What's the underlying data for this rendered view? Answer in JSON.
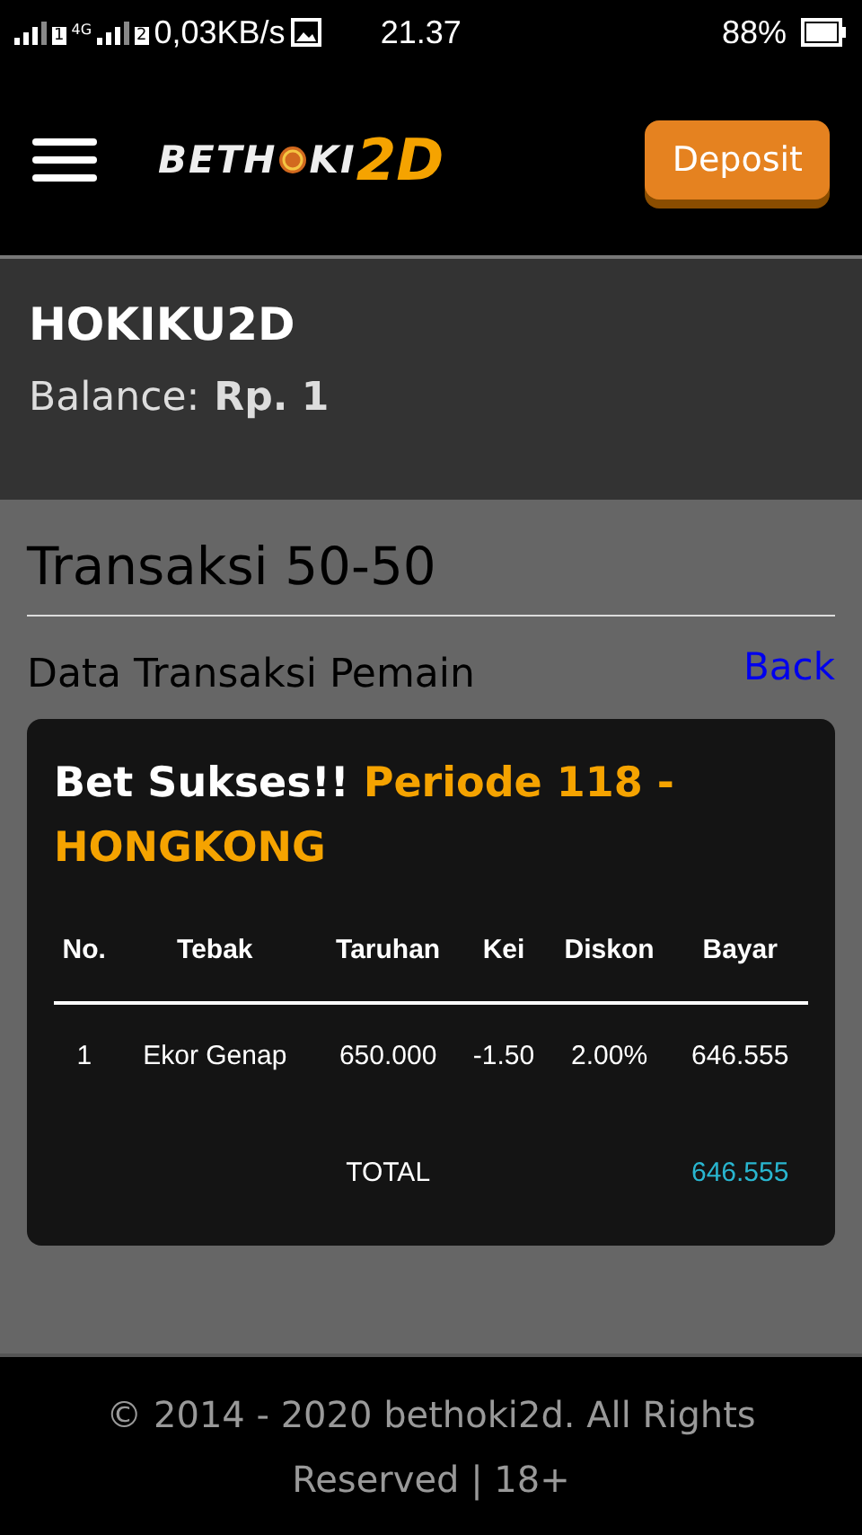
{
  "status_bar": {
    "sim_1": "1",
    "network": "4G",
    "sim_2": "2",
    "speed": "0,03KB/s",
    "time": "21.37",
    "battery": "88%"
  },
  "header": {
    "logo": {
      "left": "BETH",
      "right": "KI",
      "suffix": "2D"
    },
    "deposit_button": "Deposit"
  },
  "account": {
    "username": "HOKIKU2D",
    "balance_label": "Balance:",
    "balance_value": "Rp. 1"
  },
  "page": {
    "title": "Transaksi 50-50",
    "subtitle": "Data Transaksi Pemain",
    "back_link": "Back"
  },
  "card": {
    "title": "Bet Sukses!!",
    "period": "Periode 118 - HONGKONG",
    "columns": [
      "No.",
      "Tebak",
      "Taruhan",
      "Kei",
      "Diskon",
      "Bayar"
    ],
    "rows": [
      [
        "1",
        "Ekor Genap",
        "650.000",
        "-1.50",
        "2.00%",
        "646.555"
      ]
    ],
    "total_label": "TOTAL",
    "total_value": "646.555"
  },
  "footer": "© 2014 - 2020 bethoki2d. All Rights Reserved | 18+"
}
